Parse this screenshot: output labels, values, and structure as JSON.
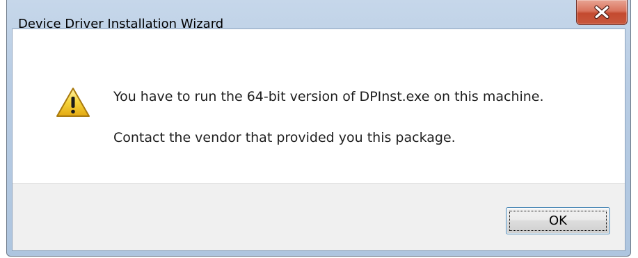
{
  "window": {
    "title": "Device Driver Installation Wizard"
  },
  "titlebar": {
    "close_icon": "close-icon"
  },
  "dialog": {
    "icon": "warning-icon",
    "message_line_1": "You have to run the 64-bit version of DPInst.exe on this machine.",
    "message_line_2": "Contact the vendor that provided you this package."
  },
  "buttons": {
    "ok_label": "OK"
  },
  "colors": {
    "close_button": "#c8573c",
    "warning_fill": "#f5d33b",
    "focus_border": "#3c7fb1"
  }
}
